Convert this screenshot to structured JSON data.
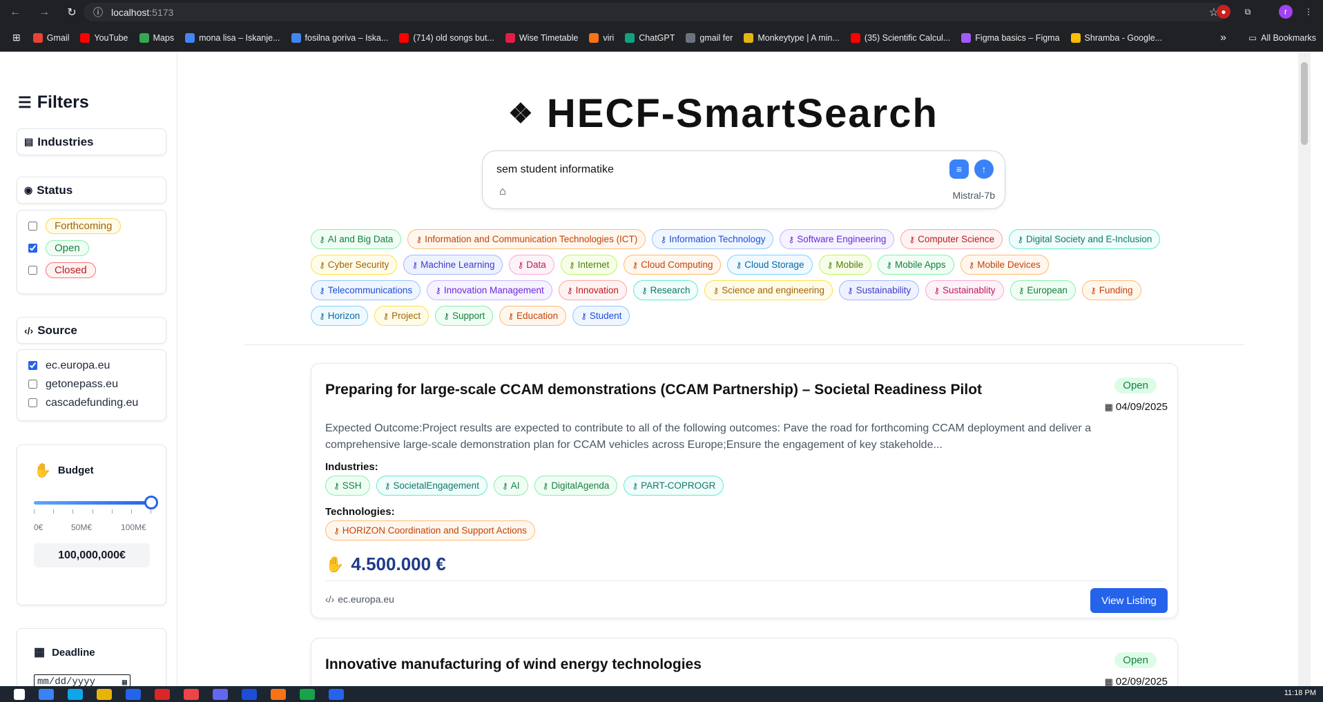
{
  "browser": {
    "url_host": "localhost",
    "url_port": ":5173",
    "bookmarks": [
      {
        "label": "Gmail",
        "color": "#ea4335"
      },
      {
        "label": "YouTube",
        "color": "#ff0000"
      },
      {
        "label": "Maps",
        "color": "#34a853"
      },
      {
        "label": "mona lisa – Iskanje...",
        "color": "#4285f4"
      },
      {
        "label": "fosilna goriva – Iska...",
        "color": "#4285f4"
      },
      {
        "label": "(714) old songs but...",
        "color": "#ff0000"
      },
      {
        "label": "Wise Timetable",
        "color": "#e11d48"
      },
      {
        "label": "viri",
        "color": "#f97316"
      },
      {
        "label": "ChatGPT",
        "color": "#10a37f"
      },
      {
        "label": "gmail fer",
        "color": "#6b7280"
      },
      {
        "label": "Monkeytype | A min...",
        "color": "#e2b714"
      },
      {
        "label": "(35) Scientific Calcul...",
        "color": "#ff0000"
      },
      {
        "label": "Figma basics – Figma",
        "color": "#a259ff"
      },
      {
        "label": "Shramba - Google...",
        "color": "#fbbc04"
      }
    ],
    "all_bookmarks": "All Bookmarks"
  },
  "sidebar": {
    "title": "Filters",
    "industries_label": "Industries",
    "status_label": "Status",
    "status_options": [
      {
        "label": "Forthcoming",
        "checked": false
      },
      {
        "label": "Open",
        "checked": true
      },
      {
        "label": "Closed",
        "checked": false
      }
    ],
    "source_label": "Source",
    "source_options": [
      {
        "label": "ec.europa.eu",
        "checked": true
      },
      {
        "label": "getonepass.eu",
        "checked": false
      },
      {
        "label": "cascadefunding.eu",
        "checked": false
      }
    ],
    "budget_label": "Budget",
    "budget_ticks": [
      "0€",
      "50M€",
      "100M€"
    ],
    "budget_value": "100,000,000€",
    "budget_fraction": 1.0,
    "deadline_label": "Deadline",
    "deadline_placeholder": "mm/dd/yyyy"
  },
  "header": {
    "title": "HECF-SmartSearch"
  },
  "search": {
    "query": "sem student informatike",
    "model": "Mistral-7b"
  },
  "keyword_tags": [
    [
      {
        "label": "AI and Big Data",
        "color": "green"
      },
      {
        "label": "Information and Communication Technologies (ICT)",
        "color": "orange"
      },
      {
        "label": "Information Technology",
        "color": "blue"
      },
      {
        "label": "Software Engineering",
        "color": "purple"
      },
      {
        "label": "Computer Science",
        "color": "red"
      },
      {
        "label": "Digital Society and E-Inclusion",
        "color": "teal"
      }
    ],
    [
      {
        "label": "Cyber Security",
        "color": "yellow"
      },
      {
        "label": "Machine Learning",
        "color": "indigo"
      },
      {
        "label": "Data",
        "color": "pink"
      },
      {
        "label": "Internet",
        "color": "lime"
      },
      {
        "label": "Cloud Computing",
        "color": "orange"
      },
      {
        "label": "Cloud Storage",
        "color": "sky"
      },
      {
        "label": "Mobile",
        "color": "lime"
      },
      {
        "label": "Mobile Apps",
        "color": "green"
      },
      {
        "label": "Mobile Devices",
        "color": "orange"
      }
    ],
    [
      {
        "label": "Telecommunications",
        "color": "blue"
      },
      {
        "label": "Innovation Management",
        "color": "purple"
      },
      {
        "label": "Innovation",
        "color": "red"
      },
      {
        "label": "Research",
        "color": "teal"
      },
      {
        "label": "Science and engineering",
        "color": "yellow"
      },
      {
        "label": "Sustainability",
        "color": "indigo"
      },
      {
        "label": "Sustainablity",
        "color": "pink"
      },
      {
        "label": "European",
        "color": "green"
      },
      {
        "label": "Funding",
        "color": "orange"
      }
    ],
    [
      {
        "label": "Horizon",
        "color": "sky"
      },
      {
        "label": "Project",
        "color": "yellow"
      },
      {
        "label": "Support",
        "color": "green"
      },
      {
        "label": "Education",
        "color": "orange"
      },
      {
        "label": "Student",
        "color": "blue"
      }
    ]
  ],
  "results": [
    {
      "title": "Preparing for large-scale CCAM demonstrations (CCAM Partnership) – Societal Readiness Pilot",
      "status": "Open",
      "date": "04/09/2025",
      "description": "Expected Outcome:Project results are expected to contribute to all of the following outcomes: Pave the road for forthcoming CCAM deployment and deliver a comprehensive large-scale demonstration plan for CCAM vehicles across Europe;Ensure the engagement of key stakeholde...",
      "industries_label": "Industries:",
      "industries": [
        {
          "label": "SSH",
          "color": "green"
        },
        {
          "label": "SocietalEngagement",
          "color": "teal"
        },
        {
          "label": "AI",
          "color": "green"
        },
        {
          "label": "DigitalAgenda",
          "color": "green"
        },
        {
          "label": "PART-COPROGR",
          "color": "teal"
        }
      ],
      "technologies_label": "Technologies:",
      "technologies": [
        {
          "label": "HORIZON Coordination and Support Actions",
          "color": "orange"
        }
      ],
      "amount": "4.500.000 €",
      "source": "ec.europa.eu",
      "button": "View Listing"
    },
    {
      "title": "Innovative manufacturing of wind energy technologies",
      "status": "Open",
      "date": "02/09/2025"
    }
  ],
  "taskbar": {
    "clock": "11:18 PM"
  }
}
